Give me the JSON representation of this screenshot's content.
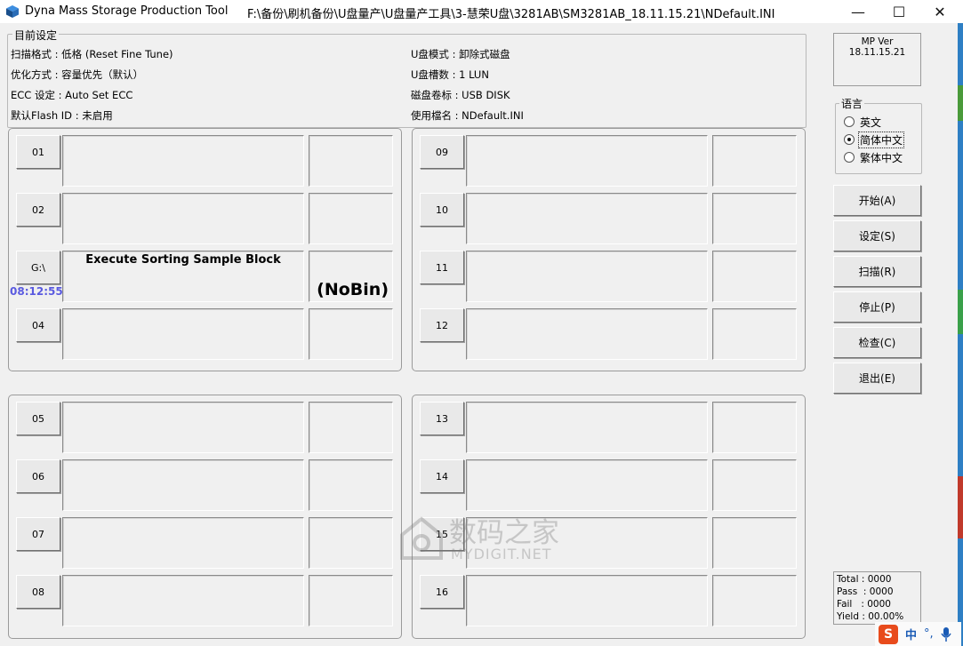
{
  "window": {
    "app_title": "Dyna Mass Storage Production Tool",
    "path_title": "F:\\备份\\刷机备份\\U盘量产\\U盘量产工具\\3-慧荣U盘\\3281AB\\SM3281AB_18.11.15.21\\NDefault.INI",
    "minimize": "—",
    "maximize": "☐",
    "close": "✕"
  },
  "settings": {
    "group_title": "目前设定",
    "scan_format": "扫描格式 : 低格 (Reset Fine Tune)",
    "optimize": "优化方式 : 容量优先（默认）",
    "ecc": "ECC 设定 : Auto Set ECC",
    "flash_id": "默认Flash ID : 未启用",
    "disk_mode": "U盘模式 : 卸除式磁盘",
    "slot_count": "U盘槽数 : 1 LUN",
    "volume_label": "磁盘卷标 : USB DISK",
    "ini_file": "使用檔名 : NDefault.INI"
  },
  "ports": {
    "p01": {
      "label": "01"
    },
    "p02": {
      "label": "02"
    },
    "p03": {
      "label": "G:\\",
      "status": "Execute Sorting Sample Block",
      "bin": "(NoBin)",
      "time": "08:12:55"
    },
    "p04": {
      "label": "04"
    },
    "p05": {
      "label": "05"
    },
    "p06": {
      "label": "06"
    },
    "p07": {
      "label": "07"
    },
    "p08": {
      "label": "08"
    },
    "p09": {
      "label": "09"
    },
    "p10": {
      "label": "10"
    },
    "p11": {
      "label": "11"
    },
    "p12": {
      "label": "12"
    },
    "p13": {
      "label": "13"
    },
    "p14": {
      "label": "14"
    },
    "p15": {
      "label": "15"
    },
    "p16": {
      "label": "16"
    }
  },
  "version": "MP Ver 18.11.15.21",
  "language": {
    "title": "语言",
    "options": [
      "英文",
      "简体中文",
      "繁体中文"
    ],
    "selected": "简体中文"
  },
  "buttons": {
    "start": "开始(A)",
    "settings": "设定(S)",
    "scan": "扫描(R)",
    "stop": "停止(P)",
    "check": "检查(C)",
    "exit": "退出(E)"
  },
  "stats": {
    "total": "Total : 0000",
    "pass": "Pass  : 0000",
    "fail": "Fail   : 0000",
    "yield": "Yield : 00.00%"
  },
  "watermark": {
    "cn": "数码之家",
    "en": "MYDIGIT.NET"
  },
  "ime": {
    "mode": "中",
    "punct": "°,"
  },
  "colors": {
    "time": "#5a5ae0",
    "window_edge": "#2e7fc4",
    "ime_logo": "#e84b1c"
  }
}
